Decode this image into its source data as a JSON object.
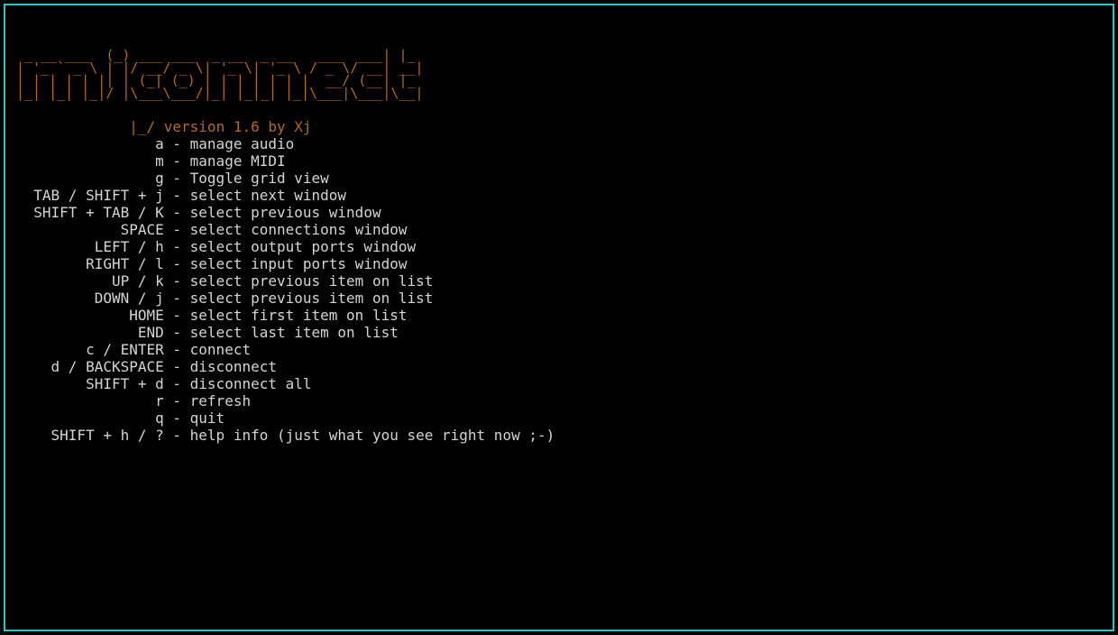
{
  "ascii_art": " _ __ ___  (_) ___ ___  _ __  _ __   ___  ___| |_\n| '_ ` _ \\ | |/ __/ _ \\| '_ \\| '_ \\ / _ \\/ __| __|\n| | | | | || | (_| (_) | | | | | | |  __/ (__| |_\n|_| |_| |_|/ |\\___\\___/|_| |_|_| |_|\\___|\\___|\\__|",
  "version_prefix": "         |_/ ",
  "version_text": "version 1.6 by Xj",
  "help": [
    {
      "key": "a",
      "desc": "manage audio"
    },
    {
      "key": "m",
      "desc": "manage MIDI"
    },
    {
      "key": "g",
      "desc": "Toggle grid view"
    },
    {
      "key": "TAB / SHIFT + j",
      "desc": "select next window"
    },
    {
      "key": "SHIFT + TAB / K",
      "desc": "select previous window"
    },
    {
      "key": "SPACE",
      "desc": "select connections window"
    },
    {
      "key": "LEFT / h",
      "desc": "select output ports window"
    },
    {
      "key": "RIGHT / l",
      "desc": "select input ports window"
    },
    {
      "key": "UP / k",
      "desc": "select previous item on list"
    },
    {
      "key": "DOWN / j",
      "desc": "select previous item on list"
    },
    {
      "key": "HOME",
      "desc": "select first item on list"
    },
    {
      "key": "END",
      "desc": "select last item on list"
    },
    {
      "key": "c / ENTER",
      "desc": "connect"
    },
    {
      "key": "d / BACKSPACE",
      "desc": "disconnect"
    },
    {
      "key": "SHIFT + d",
      "desc": "disconnect all"
    },
    {
      "key": "r",
      "desc": "refresh"
    },
    {
      "key": "q",
      "desc": "quit"
    },
    {
      "key": "SHIFT + h / ?",
      "desc": "help info (just what you see right now ;-)"
    }
  ],
  "key_col_width": 17
}
